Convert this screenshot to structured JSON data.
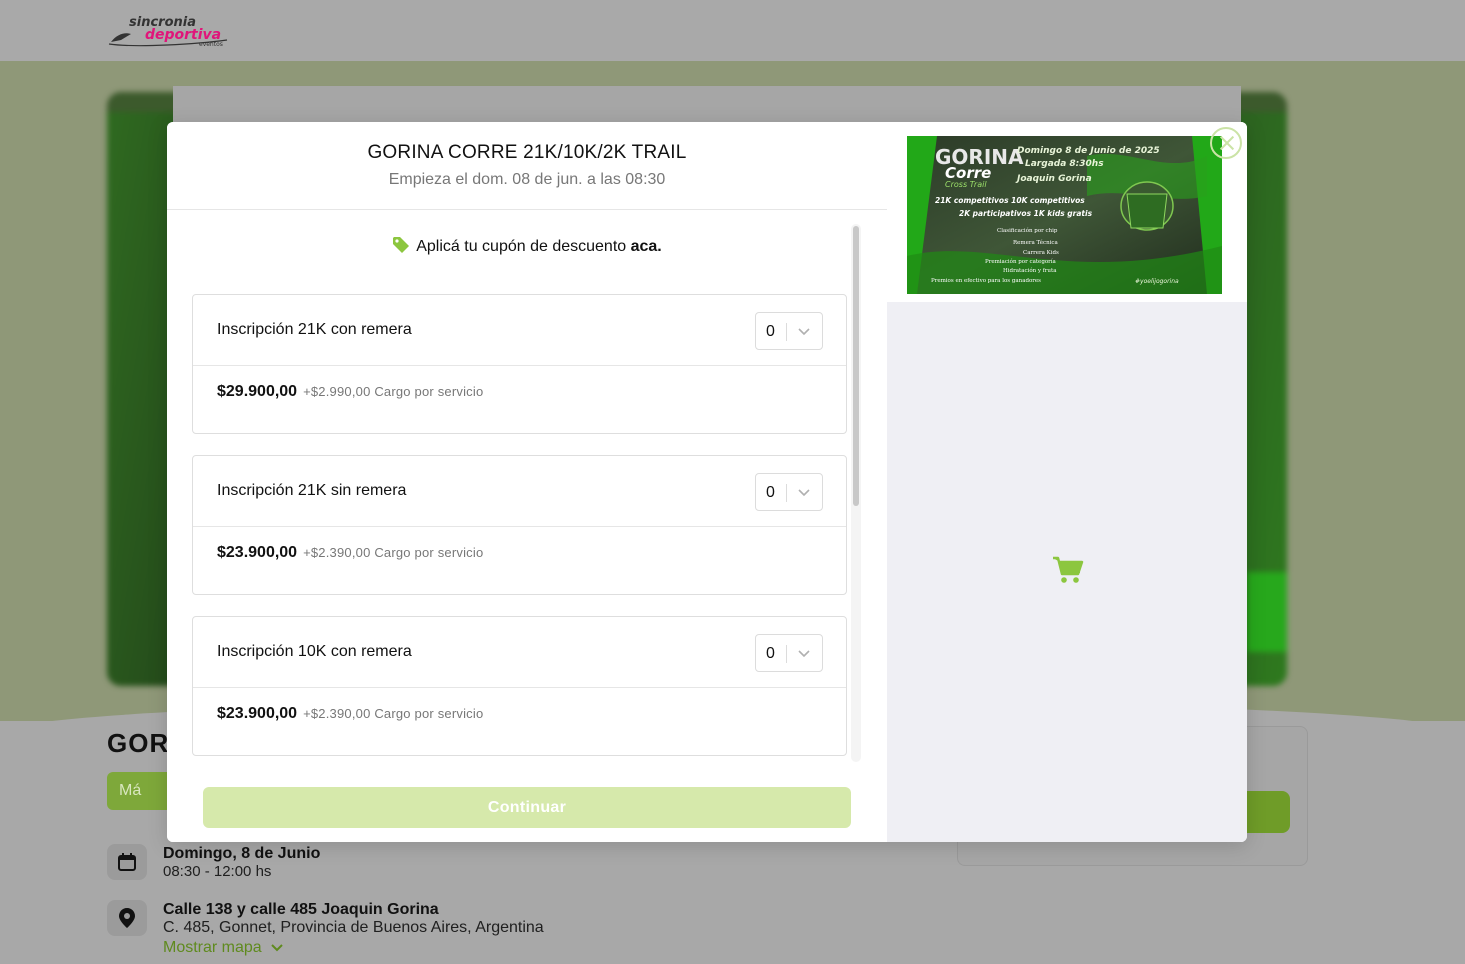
{
  "header": {
    "logo_text_1": "sincronia",
    "logo_text_2": "deportiva",
    "logo_text_3": "eventos"
  },
  "background": {
    "title_partial": "GOR",
    "chip_partial": "Má",
    "date_main": "Domingo, 8 de Junio",
    "date_sub": "08:30 - 12:00 hs",
    "location_main": "Calle 138 y calle 485 Joaquin Gorina",
    "location_sub": "C. 485, Gonnet, Provincia de Buenos Aires, Argentina",
    "map_link": "Mostrar mapa"
  },
  "modal": {
    "title": "GORINA CORRE 21K/10K/2K TRAIL",
    "subtitle": "Empieza el dom. 08 de jun. a las 08:30",
    "coupon_text": "Aplicá tu cupón de descuento ",
    "coupon_link": "aca.",
    "continue_label": "Continuar",
    "tickets": [
      {
        "name": "Inscripción 21K con remera",
        "qty": "0",
        "price": "$29.900,00",
        "fee": "+$2.990,00 Cargo por servicio"
      },
      {
        "name": "Inscripción 21K sin remera",
        "qty": "0",
        "price": "$23.900,00",
        "fee": "+$2.390,00 Cargo por servicio"
      },
      {
        "name": "Inscripción 10K con remera",
        "qty": "0",
        "price": "$23.900,00",
        "fee": "+$2.390,00 Cargo por servicio"
      }
    ],
    "scroll_position": 0.0
  },
  "poster": {
    "brand_1": "GORINA",
    "brand_2": "Corre",
    "brand_3": "Cross Trail",
    "date": "Domingo 8 de Junio de 2025",
    "start": "Largada 8:30hs",
    "place": "Joaquin Gorina",
    "line_1": "21K competitivos   10K competitivos",
    "line_2": "2K participativos   1K kids gratis",
    "features": [
      "Clasificación por chip",
      "Remera Técnica",
      "Carrera Kids",
      "Premiación por categoría",
      "Hidratación y fruta",
      "Premios en efectivo para los ganadores"
    ],
    "hashtag": "#yoelijogorina"
  },
  "colors": {
    "accent": "#8cc63f",
    "button_disabled": "#d6e9ab",
    "cart": "#8cc63f",
    "logo_pink": "#e0157a"
  }
}
